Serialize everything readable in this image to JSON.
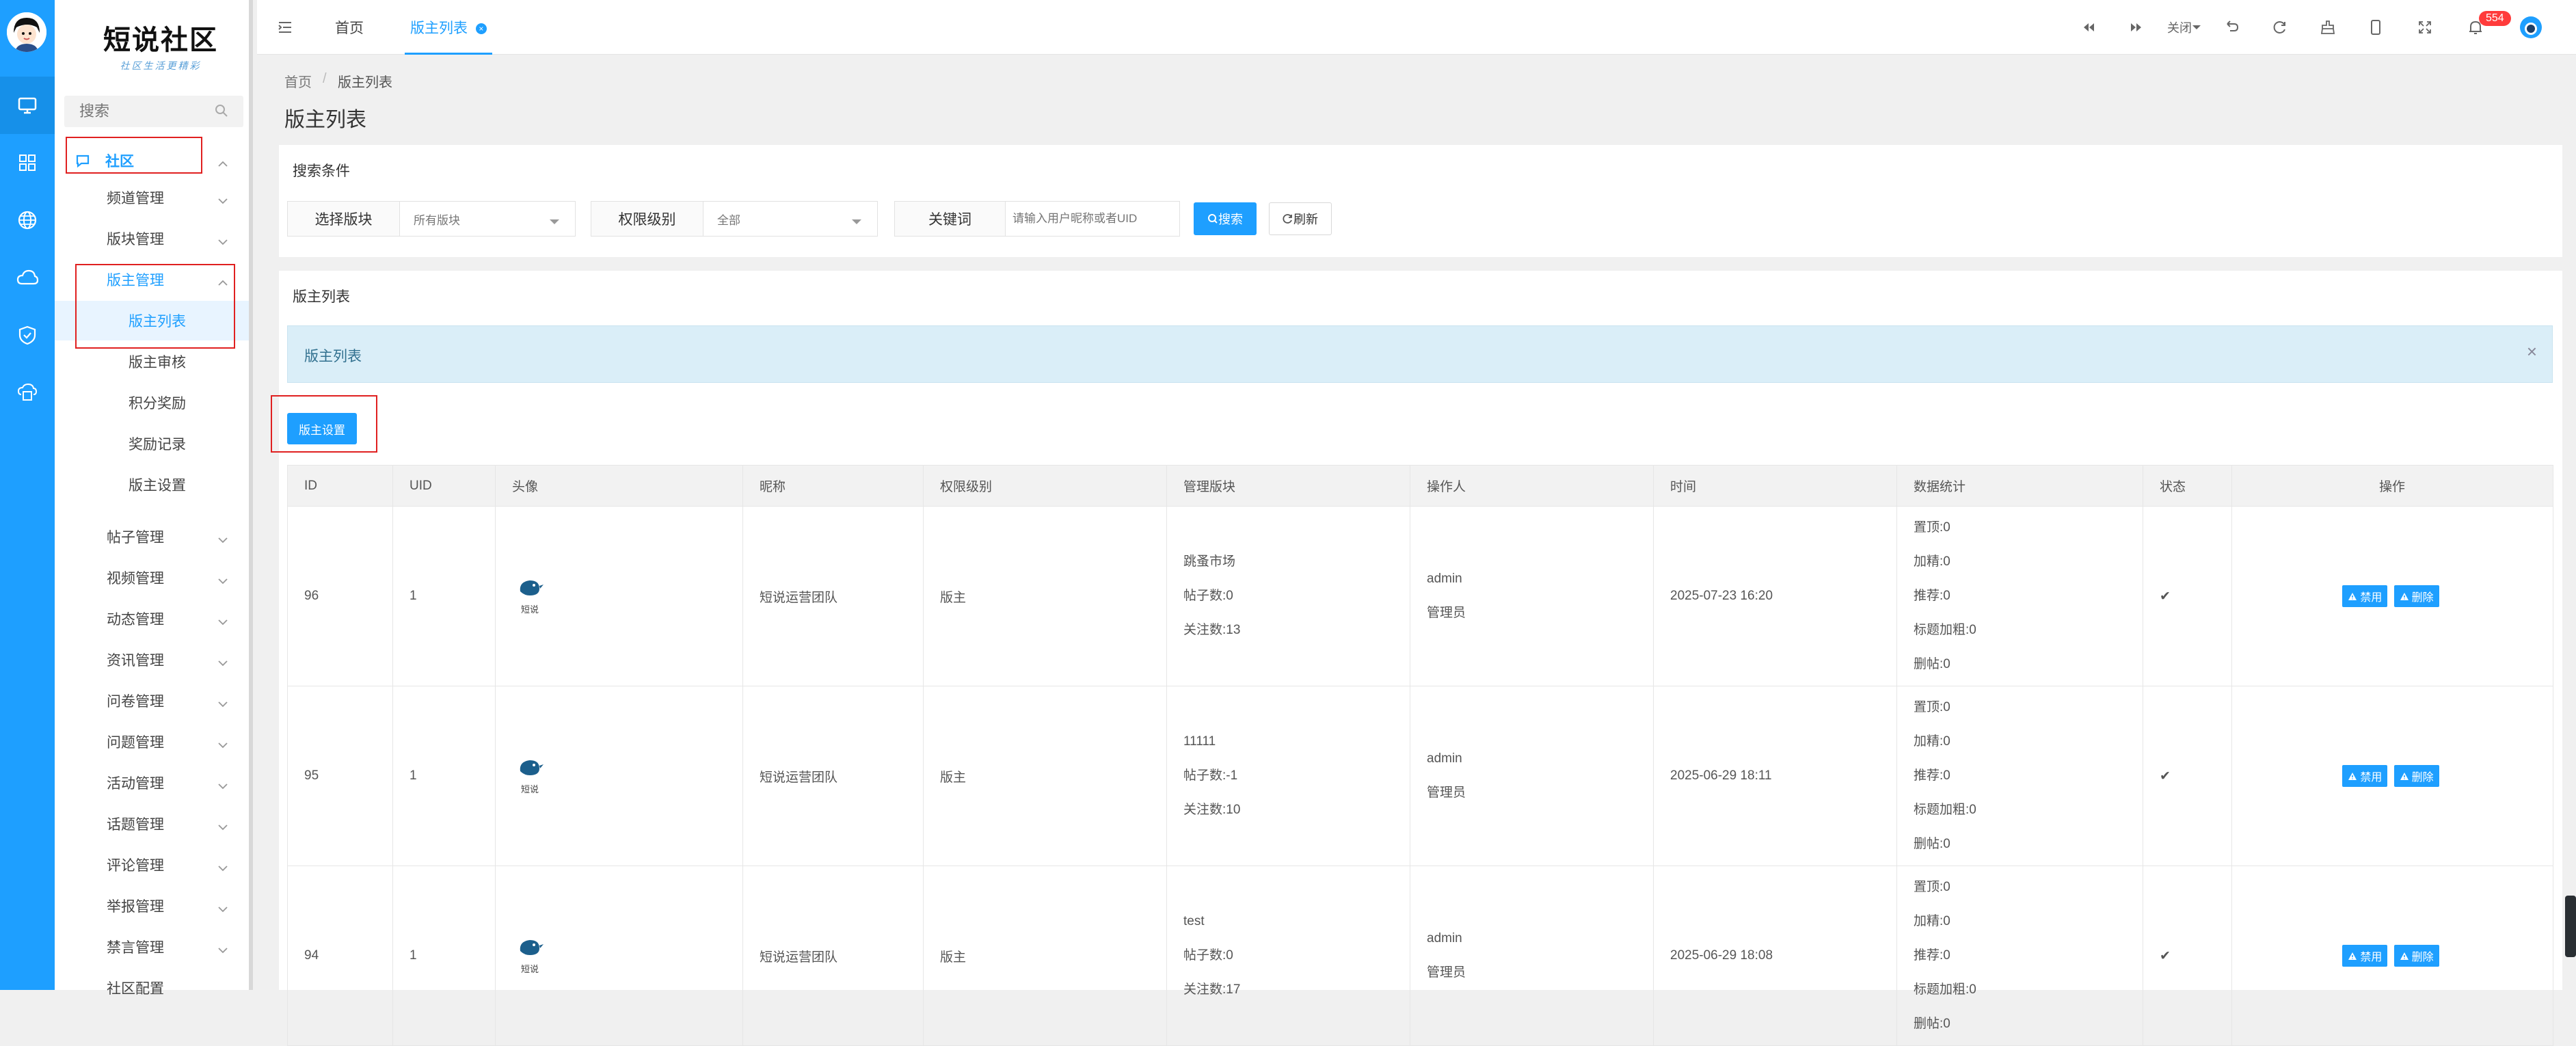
{
  "logo": {
    "title": "短说社区",
    "subtitle": "社区生活更精彩"
  },
  "sidebar": {
    "search_placeholder": "搜索",
    "community_label": "社区",
    "items": [
      {
        "label": "频道管理"
      },
      {
        "label": "版块管理"
      },
      {
        "label": "版主管理"
      },
      {
        "label": "版主列表"
      },
      {
        "label": "版主审核"
      },
      {
        "label": "积分奖励"
      },
      {
        "label": "奖励记录"
      },
      {
        "label": "版主设置"
      },
      {
        "label": "帖子管理"
      },
      {
        "label": "视频管理"
      },
      {
        "label": "动态管理"
      },
      {
        "label": "资讯管理"
      },
      {
        "label": "问卷管理"
      },
      {
        "label": "问题管理"
      },
      {
        "label": "活动管理"
      },
      {
        "label": "话题管理"
      },
      {
        "label": "评论管理"
      },
      {
        "label": "举报管理"
      },
      {
        "label": "禁言管理"
      },
      {
        "label": "社区配置"
      }
    ]
  },
  "topbar": {
    "tabs": [
      {
        "label": "首页"
      },
      {
        "label": "版主列表"
      }
    ],
    "close_label": "关闭",
    "notification_count": "554"
  },
  "breadcrumb": {
    "home": "首页",
    "sep": "/",
    "current": "版主列表"
  },
  "page_title": "版主列表",
  "search_panel": {
    "title": "搜索条件",
    "block_label": "选择版块",
    "block_value": "所有版块",
    "level_label": "权限级别",
    "level_value": "全部",
    "keyword_label": "关键词",
    "keyword_placeholder": "请输入用户昵称或者UID",
    "search_button": "搜索",
    "refresh_button": "刷新"
  },
  "list_panel": {
    "title": "版主列表",
    "alert_text": "版主列表",
    "alert_close": "×",
    "settings_button": "版主设置"
  },
  "table": {
    "headers": [
      "ID",
      "UID",
      "头像",
      "昵称",
      "权限级别",
      "管理版块",
      "操作人",
      "时间",
      "数据统计",
      "状态",
      "操作"
    ],
    "avatar_caption": "短说",
    "rows": [
      {
        "id": "96",
        "uid": "1",
        "nickname": "短说运营团队",
        "level": "版主",
        "block": "跳蚤市场",
        "posts": "帖子数:0",
        "follows": "关注数:13",
        "operator": "admin",
        "operator_role": "管理员",
        "time": "2025-07-23 16:20",
        "stats": [
          "置顶:0",
          "加精:0",
          "推荐:0",
          "标题加粗:0",
          "删帖:0"
        ],
        "status": "✔",
        "disable": "禁用",
        "delete": "删除"
      },
      {
        "id": "95",
        "uid": "1",
        "nickname": "短说运营团队",
        "level": "版主",
        "block": "11111",
        "posts": "帖子数:-1",
        "follows": "关注数:10",
        "operator": "admin",
        "operator_role": "管理员",
        "time": "2025-06-29 18:11",
        "stats": [
          "置顶:0",
          "加精:0",
          "推荐:0",
          "标题加粗:0",
          "删帖:0"
        ],
        "status": "✔",
        "disable": "禁用",
        "delete": "删除"
      },
      {
        "id": "94",
        "uid": "1",
        "nickname": "短说运营团队",
        "level": "版主",
        "block": "test",
        "posts": "帖子数:0",
        "follows": "关注数:17",
        "operator": "admin",
        "operator_role": "管理员",
        "time": "2025-06-29 18:08",
        "stats": [
          "置顶:0",
          "加精:0",
          "推荐:0",
          "标题加粗:0",
          "删帖:0"
        ],
        "status": "✔",
        "disable": "禁用",
        "delete": "删除"
      }
    ]
  },
  "colors": {
    "accent": "#1e9fff",
    "highlight_box": "#e02020",
    "alert_bg": "#daeef8"
  }
}
